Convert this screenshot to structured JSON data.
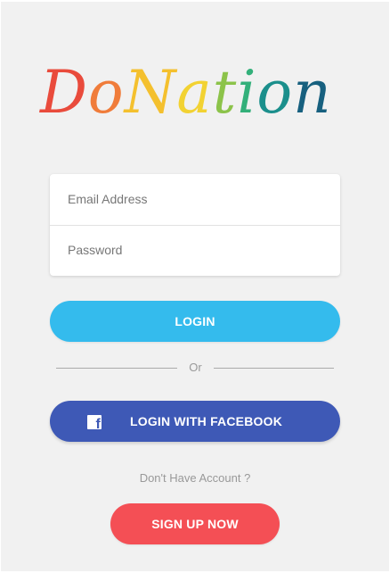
{
  "logo": {
    "letters": [
      {
        "char": "D",
        "color": "#e94b3c"
      },
      {
        "char": "o",
        "color": "#f07c3a"
      },
      {
        "char": "N",
        "color": "#f4c02e"
      },
      {
        "char": "a",
        "color": "#f2d232"
      },
      {
        "char": "t",
        "color": "#8cc34a"
      },
      {
        "char": "i",
        "color": "#33b07a"
      },
      {
        "char": "o",
        "color": "#1b8f8c"
      },
      {
        "char": "n",
        "color": "#17607f"
      }
    ]
  },
  "form": {
    "email_placeholder": "Email Address",
    "password_placeholder": "Password"
  },
  "buttons": {
    "login_label": "LOGIN",
    "facebook_label": "LOGIN WITH FACEBOOK",
    "signup_label": "SIGN UP NOW"
  },
  "divider": {
    "or_text": "Or"
  },
  "signup_prompt": "Don't Have Account ?",
  "icons": {
    "facebook": "facebook-icon"
  },
  "colors": {
    "login": "#34bbed",
    "facebook": "#3e59b6",
    "signup": "#f44f55",
    "background": "#f1f1f1"
  }
}
